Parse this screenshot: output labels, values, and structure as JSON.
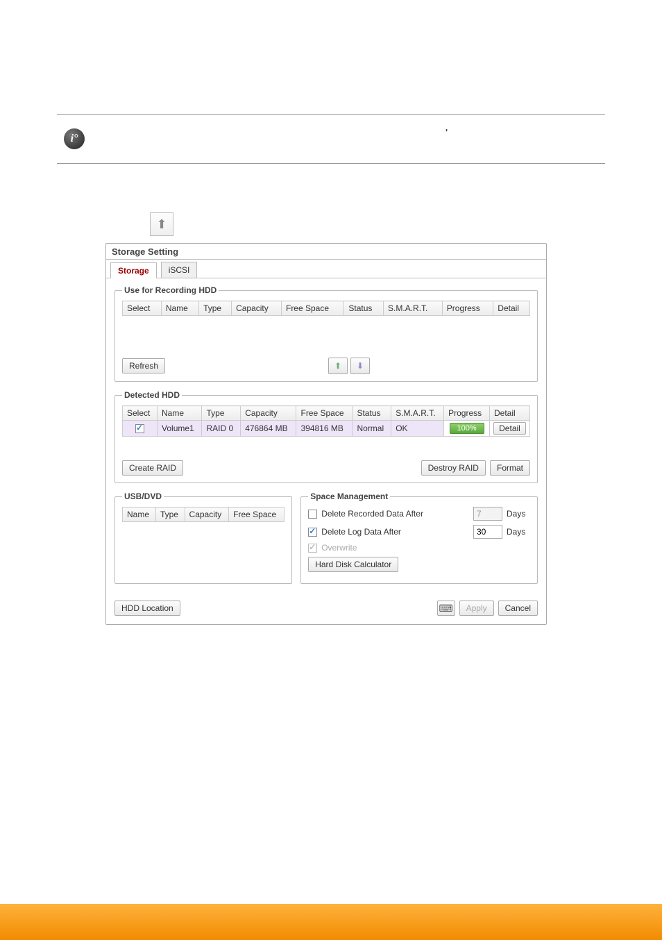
{
  "info_quote": "'",
  "top_arrow_glyph": "⬆",
  "dialog": {
    "title": "Storage Setting",
    "tabs": {
      "storage": "Storage",
      "iscsi": "iSCSI"
    }
  },
  "recording": {
    "legend": "Use for Recording HDD",
    "headers": [
      "Select",
      "Name",
      "Type",
      "Capacity",
      "Free Space",
      "Status",
      "S.M.A.R.T.",
      "Progress",
      "Detail"
    ]
  },
  "refresh_label": "Refresh",
  "arrow_up_glyph": "⬆",
  "arrow_down_glyph": "⬇",
  "detected": {
    "legend": "Detected HDD",
    "headers": [
      "Select",
      "Name",
      "Type",
      "Capacity",
      "Free Space",
      "Status",
      "S.M.A.R.T.",
      "Progress",
      "Detail"
    ],
    "row": {
      "name": "Volume1",
      "type": "RAID 0",
      "capacity": "476864 MB",
      "free": "394816 MB",
      "status": "Normal",
      "smart": "OK",
      "progress": "100%",
      "detail_btn": "Detail"
    },
    "create_raid": "Create RAID",
    "destroy_raid": "Destroy RAID",
    "format": "Format"
  },
  "usb": {
    "legend": "USB/DVD",
    "headers": [
      "Name",
      "Type",
      "Capacity",
      "Free Space"
    ]
  },
  "space": {
    "legend": "Space Management",
    "delete_recorded_label": "Delete Recorded Data After",
    "delete_recorded_value": "7",
    "delete_log_label": "Delete Log Data After",
    "delete_log_value": "30",
    "overwrite_label": "Overwrite",
    "days_label": "Days",
    "calc_btn": "Hard Disk Calculator"
  },
  "footer": {
    "hdd_location": "HDD Location",
    "keyboard_glyph": "⌨",
    "apply": "Apply",
    "cancel": "Cancel"
  }
}
